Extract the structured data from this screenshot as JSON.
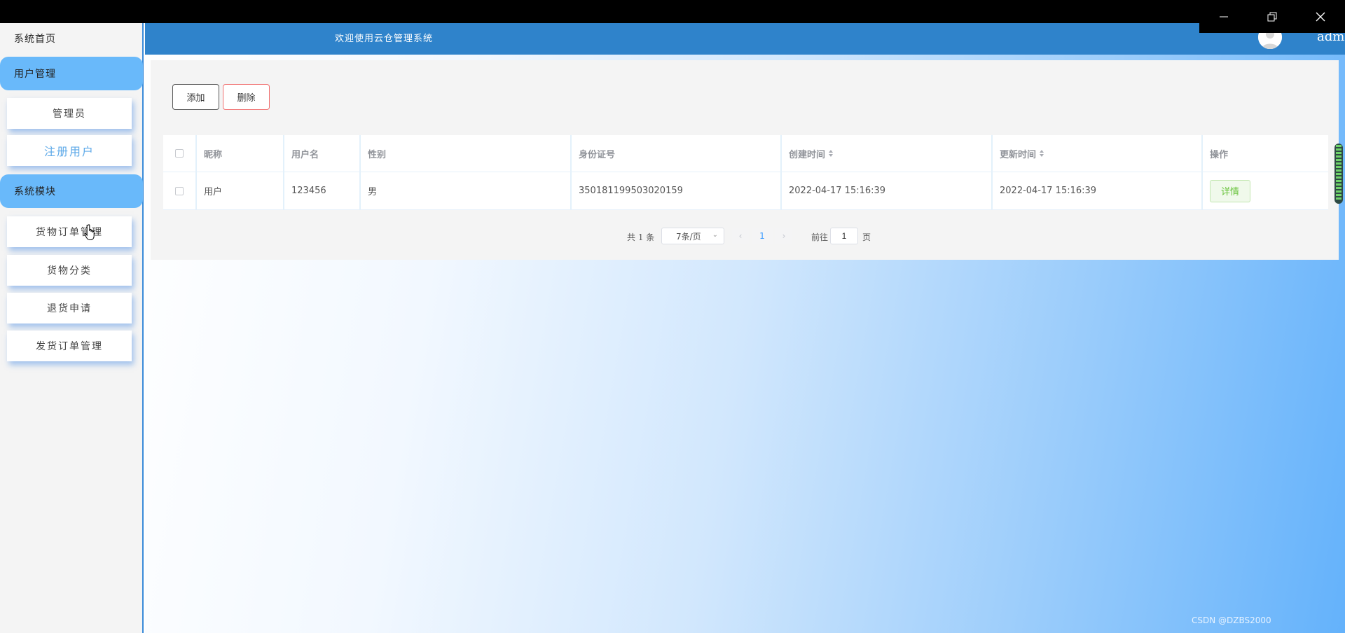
{
  "window": {
    "controls": {
      "minimize": "minimize-icon",
      "restore": "restore-icon",
      "close": "close-icon"
    }
  },
  "sidebar": {
    "home": "系统首页",
    "groups": [
      {
        "label": "用户管理",
        "items": [
          "管理员",
          "注册用户"
        ]
      },
      {
        "label": "系统模块",
        "items": [
          "货物订单管理",
          "货物分类",
          "退货申请",
          "发货订单管理"
        ]
      }
    ],
    "active_item": "注册用户"
  },
  "topbar": {
    "title": "欢迎使用云仓管理系统",
    "user": "admin",
    "avatar_icon": "user-avatar-icon"
  },
  "toolbar": {
    "add_label": "添加",
    "delete_label": "删除"
  },
  "table": {
    "headers": [
      "昵称",
      "用户名",
      "性别",
      "身份证号",
      "创建时间",
      "更新时间",
      "操作"
    ],
    "sortable": [
      "创建时间",
      "更新时间"
    ],
    "rows": [
      {
        "nickname": "用户",
        "username": "123456",
        "gender": "男",
        "id_number": "350181199503020159",
        "created": "2022-04-17 15:16:39",
        "updated": "2022-04-17 15:16:39",
        "action": "详情"
      }
    ]
  },
  "pagination": {
    "total": "共 1 条",
    "page_size": "7条/页",
    "current_page": "1",
    "goto_label": "前往",
    "goto_value": "1",
    "goto_unit": "页"
  },
  "watermark": "CSDN @DZBS2000",
  "colors": {
    "topbar": "#2f83cb",
    "sidebar_group": "#69b9fa",
    "active_item_text": "#5ea9e8",
    "delete_border": "#f07070",
    "detail_green": "#67c23a"
  }
}
